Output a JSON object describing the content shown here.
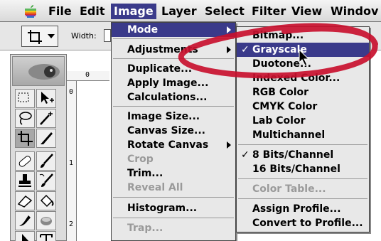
{
  "menubar": {
    "items": [
      "File",
      "Edit",
      "Image",
      "Layer",
      "Select",
      "Filter",
      "View",
      "Windov"
    ]
  },
  "options_bar": {
    "width_label": "Width:"
  },
  "rulers": {
    "h_zero": "0",
    "v_labels": [
      "0",
      "1",
      "2"
    ]
  },
  "image_menu": {
    "items": [
      {
        "label": "Mode",
        "state": "highlighted",
        "submenu": true
      },
      {
        "label": "Adjustments",
        "state": "enabled",
        "submenu": true
      },
      {
        "label": "Duplicate...",
        "state": "enabled"
      },
      {
        "label": "Apply Image...",
        "state": "enabled"
      },
      {
        "label": "Calculations...",
        "state": "enabled"
      },
      {
        "label": "Image Size...",
        "state": "enabled"
      },
      {
        "label": "Canvas Size...",
        "state": "enabled"
      },
      {
        "label": "Rotate Canvas",
        "state": "enabled",
        "submenu": true
      },
      {
        "label": "Crop",
        "state": "disabled"
      },
      {
        "label": "Trim...",
        "state": "enabled"
      },
      {
        "label": "Reveal All",
        "state": "disabled"
      },
      {
        "label": "Histogram...",
        "state": "enabled"
      },
      {
        "label": "Trap...",
        "state": "disabled"
      }
    ]
  },
  "mode_menu": {
    "items": [
      {
        "label": "Bitmap...",
        "state": "enabled"
      },
      {
        "label": "Grayscale",
        "state": "highlighted",
        "checked": true
      },
      {
        "label": "Duotone...",
        "state": "enabled"
      },
      {
        "label": "Indexed Color...",
        "state": "enabled"
      },
      {
        "label": "RGB Color",
        "state": "enabled"
      },
      {
        "label": "CMYK Color",
        "state": "enabled"
      },
      {
        "label": "Lab Color",
        "state": "enabled"
      },
      {
        "label": "Multichannel",
        "state": "enabled"
      },
      {
        "label": "8 Bits/Channel",
        "state": "enabled",
        "checked": true
      },
      {
        "label": "16 Bits/Channel",
        "state": "enabled"
      },
      {
        "label": "Color Table...",
        "state": "disabled"
      },
      {
        "label": "Assign Profile...",
        "state": "enabled"
      },
      {
        "label": "Convert to Profile...",
        "state": "enabled"
      }
    ]
  },
  "colors": {
    "highlight": "#3a3a8a",
    "annotation": "#c8102e"
  }
}
